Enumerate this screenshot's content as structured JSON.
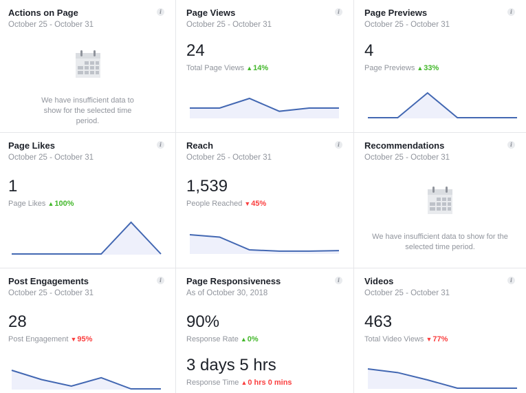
{
  "colors": {
    "line": "#4267b2",
    "fill": "#eef0fb",
    "up": "#42b72a",
    "down": "#fa3e3e",
    "muted": "#90949c",
    "text": "#1d2129"
  },
  "info_icon_glyph": "i",
  "cards": [
    {
      "id": "actions",
      "title": "Actions on Page",
      "subtitle": "October 25 - October 31",
      "empty": true,
      "empty_message": "We have insufficient data to show for the selected time period."
    },
    {
      "id": "views",
      "title": "Page Views",
      "subtitle": "October 25 - October 31",
      "value": "24",
      "label": "Total Page Views",
      "trend": "up",
      "trend_glyph": "▲",
      "change": "14%",
      "spark": [
        3,
        3,
        6,
        2,
        3,
        3
      ]
    },
    {
      "id": "previews",
      "title": "Page Previews",
      "subtitle": "October 25 - October 31",
      "value": "4",
      "label": "Page Previews",
      "trend": "up",
      "trend_glyph": "▲",
      "change": "33%",
      "spark": [
        0,
        0,
        1,
        0,
        0,
        0
      ]
    },
    {
      "id": "likes",
      "title": "Page Likes",
      "subtitle": "October 25 - October 31",
      "value": "1",
      "label": "Page Likes",
      "trend": "up",
      "trend_glyph": "▲",
      "change": "100%",
      "spark": [
        0,
        0,
        0,
        0,
        1,
        0
      ]
    },
    {
      "id": "reach",
      "title": "Reach",
      "subtitle": "October 25 - October 31",
      "value": "1,539",
      "label": "People Reached",
      "trend": "down",
      "trend_glyph": "▼",
      "change": "45%",
      "spark": [
        700,
        610,
        130,
        80,
        80,
        100
      ]
    },
    {
      "id": "recommendations",
      "title": "Recommendations",
      "subtitle": "October 25 - October 31",
      "empty": true,
      "empty_message": "We have insufficient data to show for the selected time period."
    },
    {
      "id": "engagements",
      "title": "Post Engagements",
      "subtitle": "October 25 - October 31",
      "value": "28",
      "label": "Post Engagement",
      "trend": "down",
      "trend_glyph": "▼",
      "change": "95%",
      "spark": [
        10,
        5,
        1.5,
        6,
        0,
        0
      ]
    },
    {
      "id": "responsiveness",
      "title": "Page Responsiveness",
      "subtitle": "As of October 30, 2018",
      "value": "90%",
      "label": "Response Rate",
      "trend": "up",
      "trend_glyph": "▲",
      "change": "0%",
      "value2": "3 days 5 hrs",
      "label2": "Response Time",
      "trend2": "down",
      "trend2_glyph": "▲",
      "change2": "0 hrs 0 mins"
    },
    {
      "id": "videos",
      "title": "Videos",
      "subtitle": "October 25 - October 31",
      "value": "463",
      "label": "Total Video Views",
      "trend": "down",
      "trend_glyph": "▼",
      "change": "77%",
      "spark": [
        210,
        170,
        90,
        0,
        0,
        0
      ]
    }
  ]
}
